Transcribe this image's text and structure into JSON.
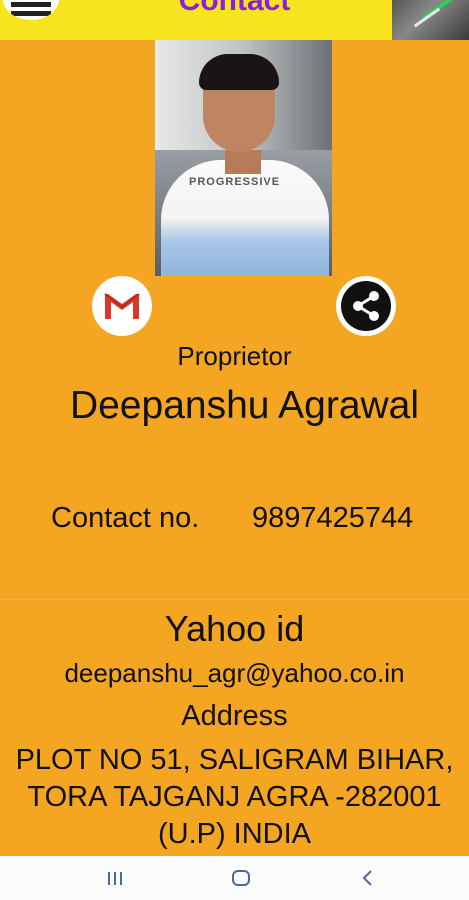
{
  "header": {
    "title": "Contact",
    "menu_icon": "menu-icon",
    "corner_image": "header-photo"
  },
  "profile": {
    "photo_icon": "profile-photo",
    "photo_print_text": "PROGRESSIVE"
  },
  "actions": {
    "gmail_icon": "gmail-icon",
    "share_icon": "share-icon"
  },
  "person": {
    "role": "Proprietor",
    "name": "Deepanshu Agrawal",
    "contact_label": "Contact no.",
    "contact_value": "9897425744"
  },
  "yahoo": {
    "label": "Yahoo id",
    "value": "deepanshu_agr@yahoo.co.in"
  },
  "address": {
    "label": "Address",
    "line1": "PLOT NO 51, SALIGRAM BIHAR,",
    "line2": "TORA TAJGANJ AGRA -282001",
    "line3": "(U.P)  INDIA"
  },
  "navbar": {
    "recent_icon": "recent-apps-icon",
    "home_icon": "home-icon",
    "back_icon": "back-icon"
  },
  "colors": {
    "background": "#f4a521",
    "topbar": "#f7e31e",
    "title": "#8a1fe0"
  }
}
